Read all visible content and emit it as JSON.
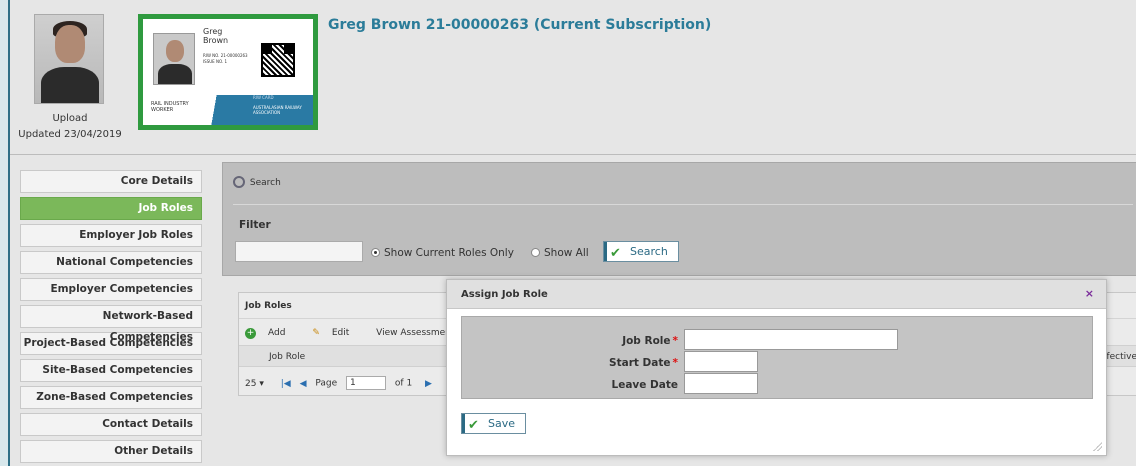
{
  "profile": {
    "upload_label": "Upload",
    "updated_label": "Updated 23/04/2019",
    "title": "Greg Brown 21-00000263 (Current Subscription)"
  },
  "card": {
    "first_name": "Greg",
    "last_name": "Brown",
    "riw_no": "RIW NO. 21-00000263",
    "issue_no": "ISSUE NO. 1",
    "logo_left": "RAIL INDUSTRY WORKER",
    "logo_right": "AUSTRALASIAN RAILWAY ASSOCIATION",
    "band_hint": "RIW CARD"
  },
  "sidebar": {
    "items": [
      {
        "label": "Core Details",
        "active": false
      },
      {
        "label": "Job Roles",
        "active": true
      },
      {
        "label": "Employer Job Roles",
        "active": false
      },
      {
        "label": "National Competencies",
        "active": false
      },
      {
        "label": "Employer Competencies",
        "active": false
      },
      {
        "label": "Network-Based Competencies",
        "active": false
      },
      {
        "label": "Project-Based Competencies",
        "active": false
      },
      {
        "label": "Site-Based Competencies",
        "active": false
      },
      {
        "label": "Zone-Based Competencies",
        "active": false
      },
      {
        "label": "Contact Details",
        "active": false
      },
      {
        "label": "Other Details",
        "active": false
      }
    ]
  },
  "search": {
    "header": "Search",
    "filter_label": "Filter",
    "filter_value": "",
    "radio_current": "Show Current Roles Only",
    "radio_all": "Show All",
    "selected": "Show Current Roles Only",
    "button": "Search"
  },
  "job_roles": {
    "header": "Job Roles",
    "add": "Add",
    "edit": "Edit",
    "view_notes": "View Assessment Notes",
    "col_job_role": "Job Role",
    "col_effective": "Effective",
    "page_size": "25",
    "page_label": "Page",
    "page_value": "1",
    "of_label": "of 1"
  },
  "modal": {
    "title": "Assign Job Role",
    "close": "×",
    "job_role_label": "Job Role",
    "start_date_label": "Start Date",
    "leave_date_label": "Leave Date",
    "required_mark": "*",
    "save": "Save"
  }
}
